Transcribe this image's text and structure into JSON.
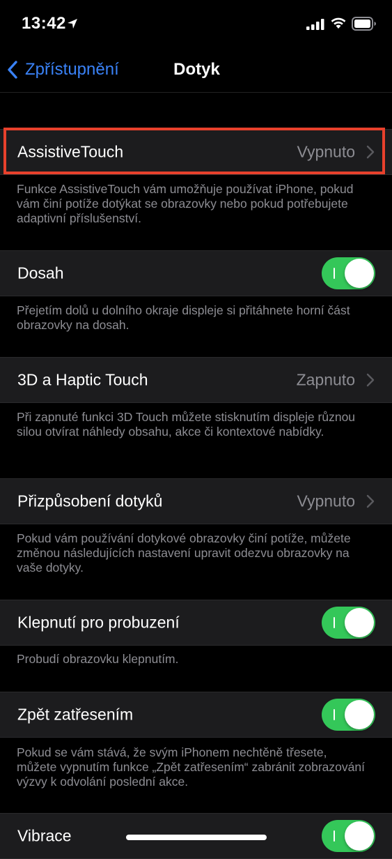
{
  "status_bar": {
    "time": "13:42"
  },
  "nav": {
    "back_label": "Zpřístupnění",
    "title": "Dotyk"
  },
  "settings": {
    "assistive_touch": {
      "label": "AssistiveTouch",
      "value": "Vypnuto",
      "footer": "Funkce AssistiveTouch vám umožňuje používat iPhone, pokud vám činí potíže dotýkat se obrazovky nebo pokud potřebujete adaptivní příslušenství."
    },
    "reachability": {
      "label": "Dosah",
      "enabled": true,
      "footer": "Přejetím dolů u dolního okraje displeje si přitáhnete horní část obrazovky na dosah."
    },
    "haptic_touch": {
      "label": "3D a Haptic Touch",
      "value": "Zapnuto",
      "footer": "Při zapnuté funkci 3D Touch můžete stisknutím displeje různou silou otvírat náhledy obsahu, akce či kontextové nabídky."
    },
    "touch_accommodations": {
      "label": "Přizpůsobení dotyků",
      "value": "Vypnuto",
      "footer": "Pokud vám používání dotykové obrazovky činí potíže, můžete změnou následujících nastavení upravit odezvu obrazovky na vaše dotyky."
    },
    "tap_to_wake": {
      "label": "Klepnutí pro probuzení",
      "enabled": true,
      "footer": "Probudí obrazovku klepnutím."
    },
    "shake_to_undo": {
      "label": "Zpět zatřesením",
      "enabled": true,
      "footer": "Pokud se vám stává, že svým iPhonem nechtěně třesete, můžete vypnutím funkce „Zpět zatřesením“ zabránit zobrazování výzvy k odvolání poslední akce."
    },
    "vibration": {
      "label": "Vibrace",
      "enabled": true
    }
  },
  "colors": {
    "accent": "#3a82f7",
    "toggle_on": "#34c759",
    "highlight": "#e8412c",
    "cell_background": "#1c1c1e",
    "secondary_text": "#8d8d93"
  }
}
